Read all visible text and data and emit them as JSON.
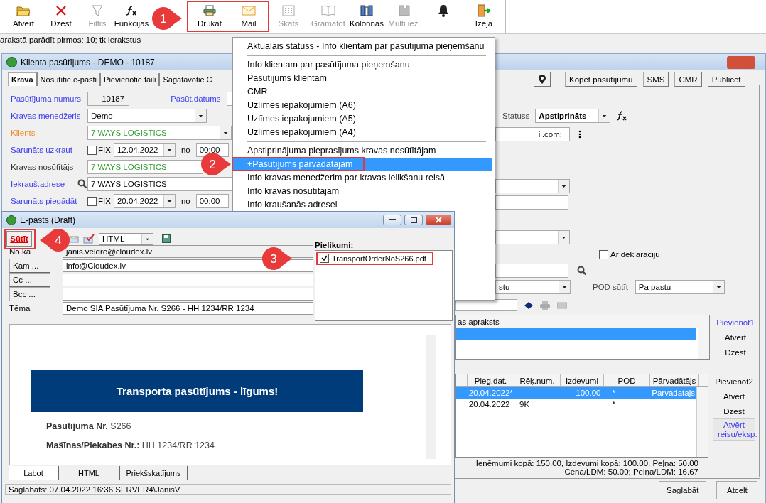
{
  "toolbar": {
    "buttons": [
      {
        "kind": "open",
        "label": "Atvērt",
        "disabled": false
      },
      {
        "kind": "delete",
        "label": "Dzēst",
        "disabled": false
      },
      {
        "kind": "filter",
        "label": "Filtrs",
        "disabled": true
      },
      {
        "kind": "functions",
        "label": "Funkcijas",
        "disabled": false
      },
      {
        "kind": "hidden"
      },
      {
        "kind": "print",
        "label": "Drukāt",
        "disabled": false
      },
      {
        "kind": "mail",
        "label": "Mail",
        "disabled": false
      },
      {
        "kind": "view",
        "label": "Skats",
        "disabled": true
      },
      {
        "kind": "book",
        "label": "Grāmatot",
        "disabled": true
      },
      {
        "kind": "columns",
        "label": "Kolonnas",
        "disabled": false
      },
      {
        "kind": "multi",
        "label": "Multi iez.",
        "disabled": true
      },
      {
        "kind": "bell"
      },
      {
        "kind": "exit",
        "label": "Izeja",
        "disabled": false
      }
    ]
  },
  "status_line": "arakstā parādīt pirmos: 10; tk ierakstus",
  "order_window": {
    "title": "Klienta pasūtījums - DEMO  - 10187",
    "tabs": [
      {
        "label": "Krava",
        "selected": true
      },
      {
        "label": "Nosūtītie e-pasti",
        "selected": false
      },
      {
        "label": "Pievienotie faili",
        "selected": false
      },
      {
        "label": "Sagatavotie C",
        "selected": false
      }
    ],
    "fields": [
      {
        "kind": "number",
        "label": "Pasūtījuma numurs",
        "color": "#3c3cf0",
        "value": "10187",
        "extra_label": "Pasūt.datums"
      },
      {
        "kind": "dropdown",
        "label": "Kravas menedžeris",
        "color": "#3c3cf0",
        "value": {
          "text": "Demo",
          "color": "#000000"
        }
      },
      {
        "kind": "dropdown",
        "label": "Klients",
        "color": "#f08c28",
        "value": {
          "text": "7 WAYS LOGISTICS",
          "color": "#2ea02e"
        }
      },
      {
        "kind": "datetime",
        "label": "Sarunāts uzkraut",
        "color": "#3c3cf0",
        "fix_label": "FIX",
        "checked": false,
        "date": "12.04.2022",
        "from_label": "no",
        "time": "00:00"
      },
      {
        "kind": "text",
        "label": "Kravas nosūtītājs",
        "color": "#333333",
        "value": {
          "text": "7 WAYS LOGISTICS",
          "color": "#2ea02e"
        }
      },
      {
        "kind": "search",
        "label": "Iekrauš.adrese",
        "color": "#3c3cf0",
        "value": {
          "text": "7 WAYS LOGISTICS",
          "color": "#000000"
        }
      },
      {
        "kind": "datetime",
        "label": "Sarunāts piegādāt",
        "color": "#3c3cf0",
        "fix_label": "FIX",
        "checked": false,
        "date": "20.04.2022",
        "from_label": "no",
        "time": "00:00"
      }
    ],
    "actions": [
      {
        "kind": "pin"
      },
      {
        "kind": "text",
        "label": "Kopēt pasūtījumu"
      },
      {
        "kind": "text",
        "label": "SMS"
      },
      {
        "kind": "text",
        "label": "CMR"
      },
      {
        "kind": "text",
        "label": "Publicēt"
      }
    ],
    "status": {
      "label": "Statuss",
      "value": "Apstiprināts"
    },
    "email_value": "il.com;",
    "declaration": {
      "label": "Ar deklarāciju",
      "checked": false
    },
    "send_method": "stu",
    "pod": {
      "label": "POD sūtīt",
      "value": "Pa pastu"
    },
    "cargo_grid": {
      "columns": [
        "as apraksts"
      ],
      "rows": [
        {
          "selected": true
        }
      ]
    },
    "cargo_buttons": [
      {
        "kind": "link",
        "label": "Pievienot1"
      },
      {
        "kind": "plain",
        "label": "Atvērt"
      },
      {
        "kind": "plain",
        "label": "Dzēst"
      }
    ],
    "trips_grid": {
      "columns": [
        "Pieg.dat.",
        "Rēķ.num.",
        "Izdevumi",
        "POD",
        "Pārvadātājs"
      ],
      "rows": [
        {
          "selected": true,
          "cells": [
            "20.04.2022*",
            null,
            "100.00",
            "*",
            "Parvadatajs"
          ]
        },
        {
          "selected": false,
          "cells": [
            "20.04.2022",
            "9K",
            null,
            "*",
            null
          ]
        }
      ]
    },
    "trips_buttons": [
      {
        "kind": "plain",
        "label": "Pievienot2"
      },
      {
        "kind": "plain",
        "label": "Atvērt"
      },
      {
        "kind": "plain",
        "label": "Dzēst"
      },
      {
        "kind": "panel",
        "label": "Atvērt reisu/eksp."
      }
    ],
    "totals": [
      "Ieņēmumi kopā: 150.00, Izdevumi kopā: 100.00, Peļņa: 50.00",
      "Cena/LDM: 50.00; Peļņa/LDM: 16.67"
    ],
    "footer_buttons": [
      "Saglabāt",
      "Atcelt"
    ]
  },
  "print_menu": {
    "groups": [
      {
        "items": [
          {
            "label": "Aktuālais statuss - Info klientam par pasūtījuma pieņemšanu",
            "selected": false
          }
        ]
      },
      {
        "items": [
          {
            "label": "Info klientam par pasūtījuma pieņemšanu",
            "selected": false
          },
          {
            "label": "Pasūtījums klientam",
            "selected": false
          },
          {
            "label": "CMR",
            "selected": false
          },
          {
            "label": "Uzlīmes iepakojumiem (A6)",
            "selected": false
          },
          {
            "label": "Uzlīmes iepakojumiem (A5)",
            "selected": false
          },
          {
            "label": "Uzlīmes iepakojumiem (A4)",
            "selected": false
          }
        ]
      },
      {
        "items": [
          {
            "label": "Apstiprinājuma pieprasījums kravas nosūtītājam",
            "selected": false
          },
          {
            "label": "+Pasūtījums pārvadātājam",
            "selected": true
          },
          {
            "label": "Info kravas menedžerim par kravas ielikšanu reisā",
            "selected": false
          },
          {
            "label": "Info kravas nosūtītājam",
            "selected": false
          },
          {
            "label": "Info kraušanās adresei",
            "selected": false
          }
        ]
      }
    ]
  },
  "email_window": {
    "title": "E-pasts (Draft)",
    "send_button": "Sūtīt",
    "format": "HTML",
    "attachments_label": "Pielikumi:",
    "attachments": [
      {
        "name": "TransportOrderNoS266.pdf",
        "checked": true
      }
    ],
    "fields": [
      {
        "kind": "label",
        "label": "No kā",
        "value": "janis.veldre@cloudex.lv"
      },
      {
        "kind": "button",
        "label": "Kam ...",
        "value": "info@Cloudex.lv"
      },
      {
        "kind": "button",
        "label": "Cc ..."
      },
      {
        "kind": "button",
        "label": "Bcc ..."
      },
      {
        "kind": "text",
        "label": "Tēma",
        "value": "Demo SIA Pasūtījuma Nr. S266 - HH 1234/RR 1234"
      }
    ],
    "body": {
      "banner": "Transporta pasūtījums - līgums!",
      "lines": [
        {
          "label": "Pasūtījuma Nr.",
          "value": "S266"
        },
        {
          "label": "Mašīnas/Piekabes Nr.:",
          "value": "HH 1234/RR 1234"
        }
      ]
    },
    "tabs": [
      {
        "label": "Labot",
        "selected": true
      },
      {
        "label": "HTML",
        "selected": false
      },
      {
        "label": "Priekšskatījums",
        "selected": false
      }
    ],
    "status": "Saglabāts: 07.04.2022 16:36 SERVER4\\JanisV"
  },
  "annotations": [
    {
      "number": "1"
    },
    {
      "number": "2"
    },
    {
      "number": "3"
    },
    {
      "number": "4"
    }
  ]
}
